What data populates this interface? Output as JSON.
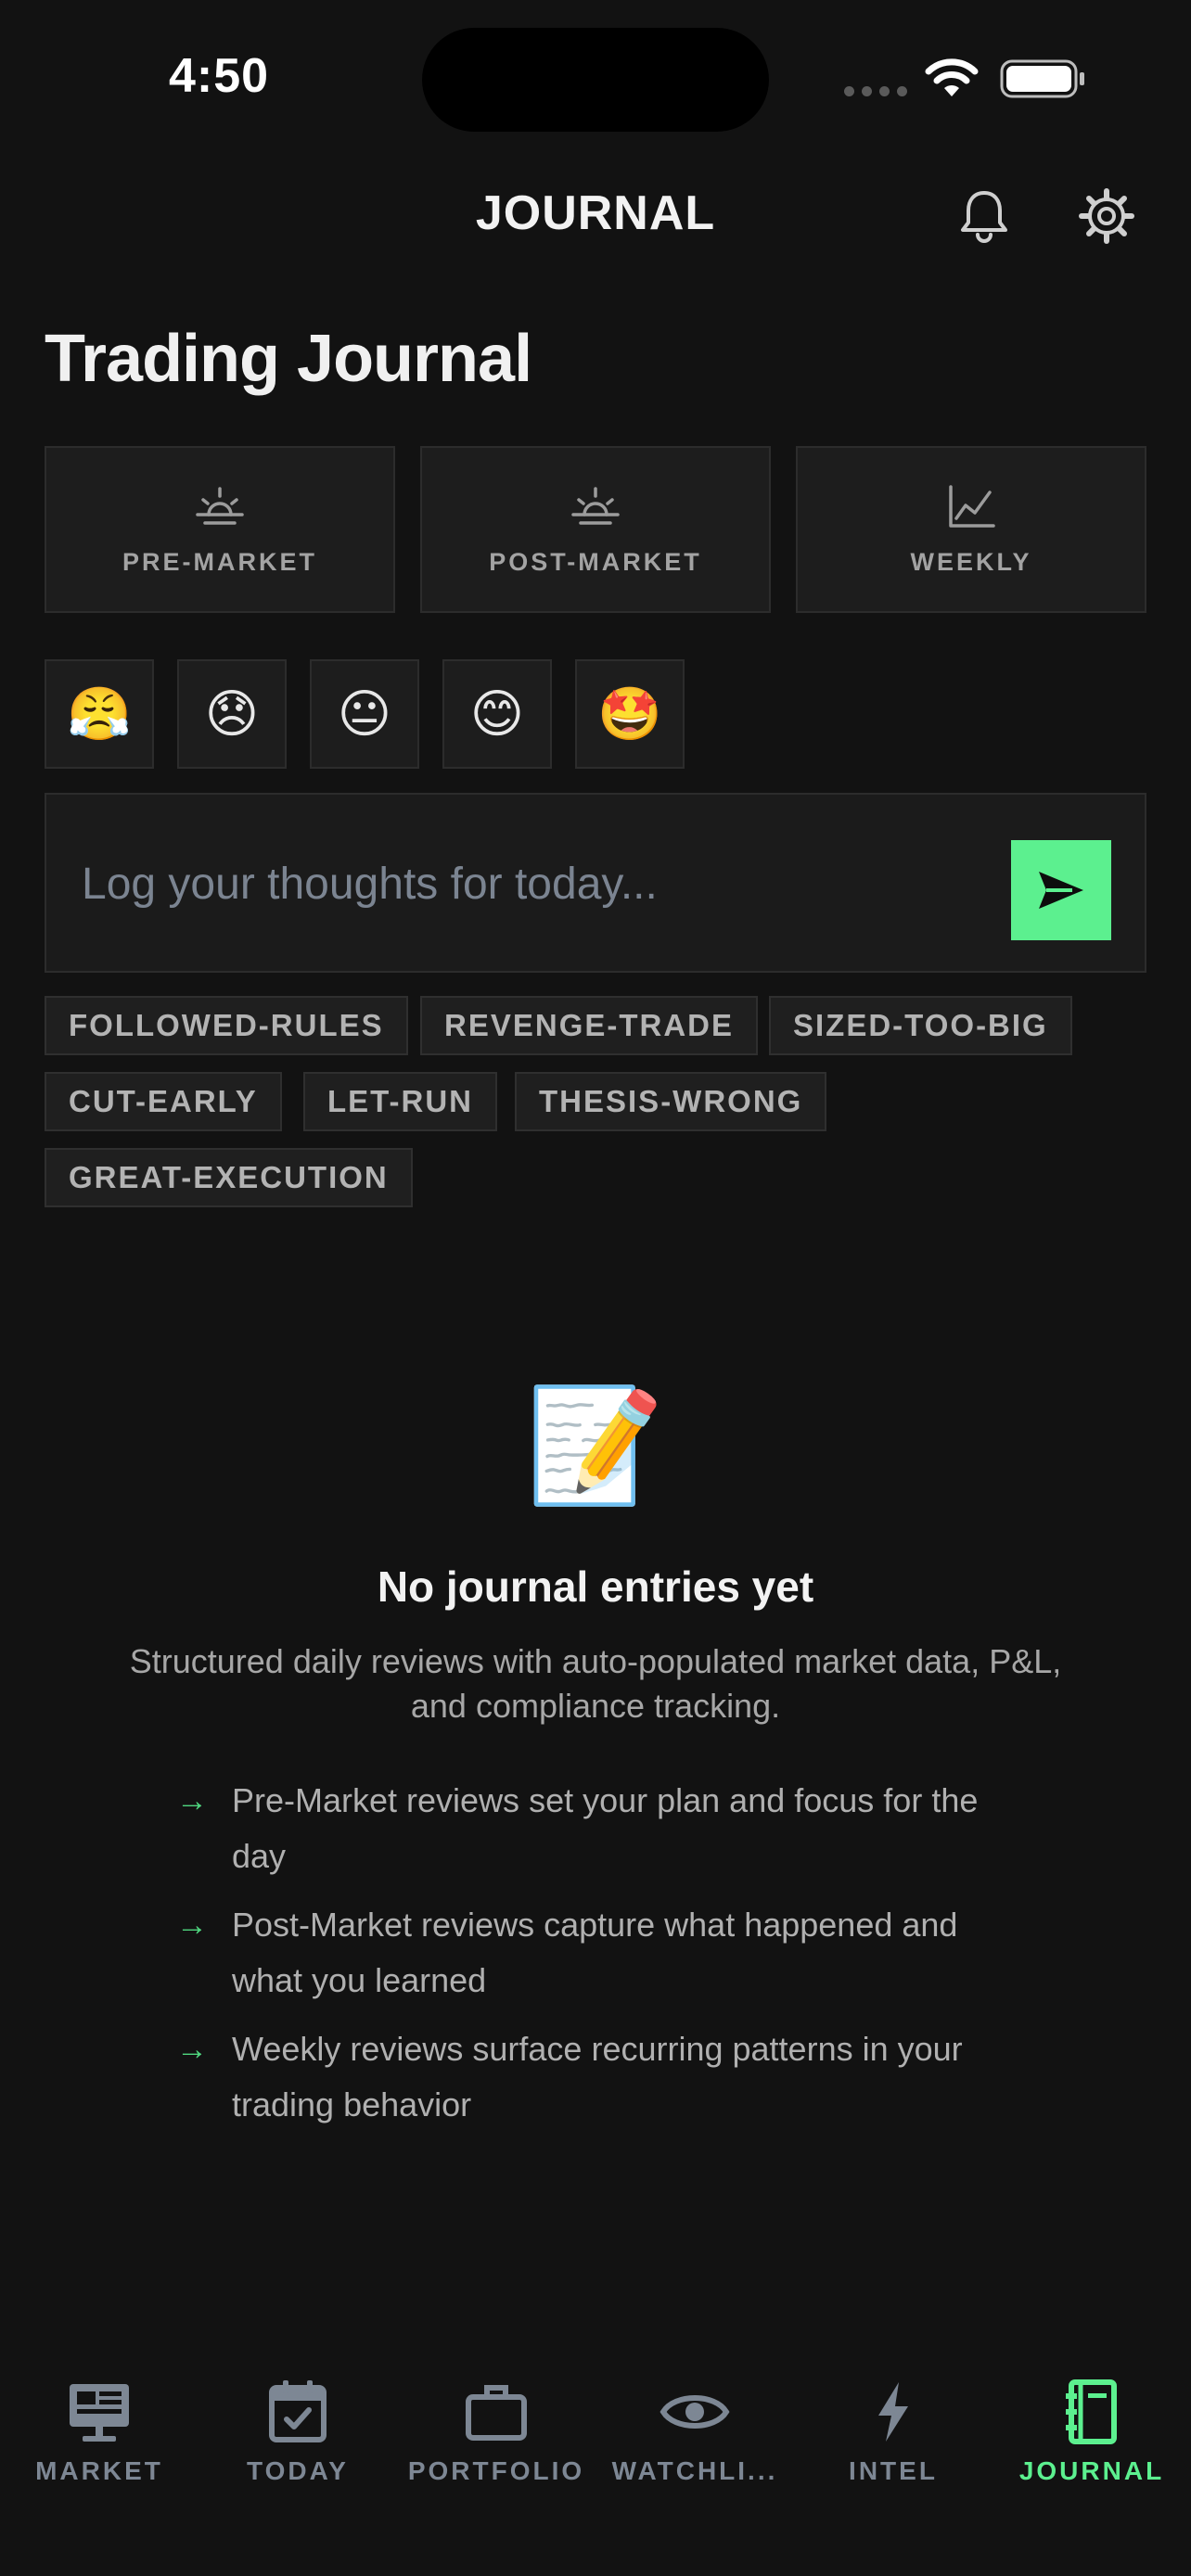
{
  "status_bar": {
    "time": "4:50"
  },
  "header": {
    "title": "JOURNAL",
    "icons": [
      "bell-icon",
      "gear-icon"
    ]
  },
  "page": {
    "title": "Trading Journal"
  },
  "review_types": [
    {
      "label": "PRE-MARKET",
      "icon": "sunrise-icon"
    },
    {
      "label": "POST-MARKET",
      "icon": "sunset-icon"
    },
    {
      "label": "WEEKLY",
      "icon": "chart-line-icon"
    }
  ],
  "moods": [
    "😤",
    "😞",
    "😐",
    "😊",
    "🤩"
  ],
  "entry": {
    "placeholder": "Log your thoughts for today...",
    "value": ""
  },
  "tags": [
    "FOLLOWED-RULES",
    "REVENGE-TRADE",
    "SIZED-TOO-BIG",
    "CUT-EARLY",
    "LET-RUN",
    "THESIS-WRONG",
    "GREAT-EXECUTION"
  ],
  "empty_state": {
    "emoji": "📝",
    "title": "No journal entries yet",
    "description": "Structured daily reviews with auto-populated market data, P&L, and compliance tracking.",
    "bullets": [
      "Pre-Market reviews set your plan and focus for the day",
      "Post-Market reviews capture what happened and what you learned",
      "Weekly reviews surface recurring patterns in your trading behavior"
    ]
  },
  "nav": {
    "items": [
      {
        "label": "MARKET",
        "icon": "monitor-icon"
      },
      {
        "label": "TODAY",
        "icon": "calendar-icon"
      },
      {
        "label": "PORTFOLIO",
        "icon": "briefcase-icon"
      },
      {
        "label": "WATCHLI...",
        "icon": "eye-icon"
      },
      {
        "label": "INTEL",
        "icon": "lightning-icon"
      },
      {
        "label": "JOURNAL",
        "icon": "journal-icon"
      }
    ],
    "active": "JOURNAL"
  },
  "colors": {
    "accent": "#5cf08f",
    "background": "#121212",
    "card": "#1d1d1d",
    "muted": "#7d8794"
  }
}
